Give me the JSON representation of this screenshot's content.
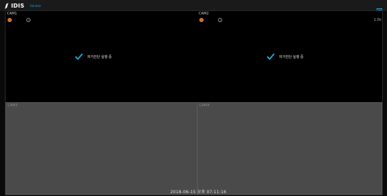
{
  "app": {
    "logo_text": "IDIS",
    "logo_sub": "Solution"
  },
  "cameras": [
    {
      "label": "CAM1",
      "status_text": "자가진단 실행 중"
    },
    {
      "label": "CAM2",
      "status_text": "자가진단 실행 중",
      "zoom": "1.0x"
    },
    {
      "label": "CAM3"
    },
    {
      "label": "CAM4"
    }
  ],
  "status": {
    "datetime": "2018-06-15 오후 07:11:16"
  },
  "colors": {
    "accent": "#1fa3d6",
    "record": "#c96f1f",
    "panel_empty": "#4a4a4a"
  }
}
